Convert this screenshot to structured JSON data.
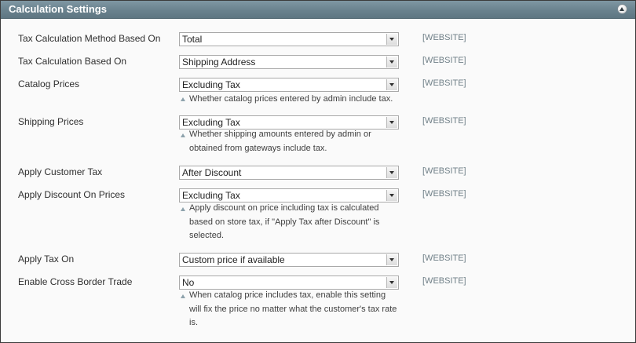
{
  "panel": {
    "title": "Calculation Settings"
  },
  "rows": [
    {
      "label": "Tax Calculation Method Based On",
      "value": "Total",
      "scope": "[WEBSITE]",
      "note": ""
    },
    {
      "label": "Tax Calculation Based On",
      "value": "Shipping Address",
      "scope": "[WEBSITE]",
      "note": ""
    },
    {
      "label": "Catalog Prices",
      "value": "Excluding Tax",
      "scope": "[WEBSITE]",
      "note": "Whether catalog prices entered by admin include tax."
    },
    {
      "label": "Shipping Prices",
      "value": "Excluding Tax",
      "scope": "[WEBSITE]",
      "note": "Whether shipping amounts entered by admin or obtained from gateways include tax."
    },
    {
      "label": "Apply Customer Tax",
      "value": "After Discount",
      "scope": "[WEBSITE]",
      "note": ""
    },
    {
      "label": "Apply Discount On Prices",
      "value": "Excluding Tax",
      "scope": "[WEBSITE]",
      "note": "Apply discount on price including tax is calculated based on store tax, if \"Apply Tax after Discount\" is selected."
    },
    {
      "label": "Apply Tax On",
      "value": "Custom price if available",
      "scope": "[WEBSITE]",
      "note": ""
    },
    {
      "label": "Enable Cross Border Trade",
      "value": "No",
      "scope": "[WEBSITE]",
      "note": "When catalog price includes tax, enable this setting will fix the price no matter what the customer's tax rate is."
    }
  ]
}
